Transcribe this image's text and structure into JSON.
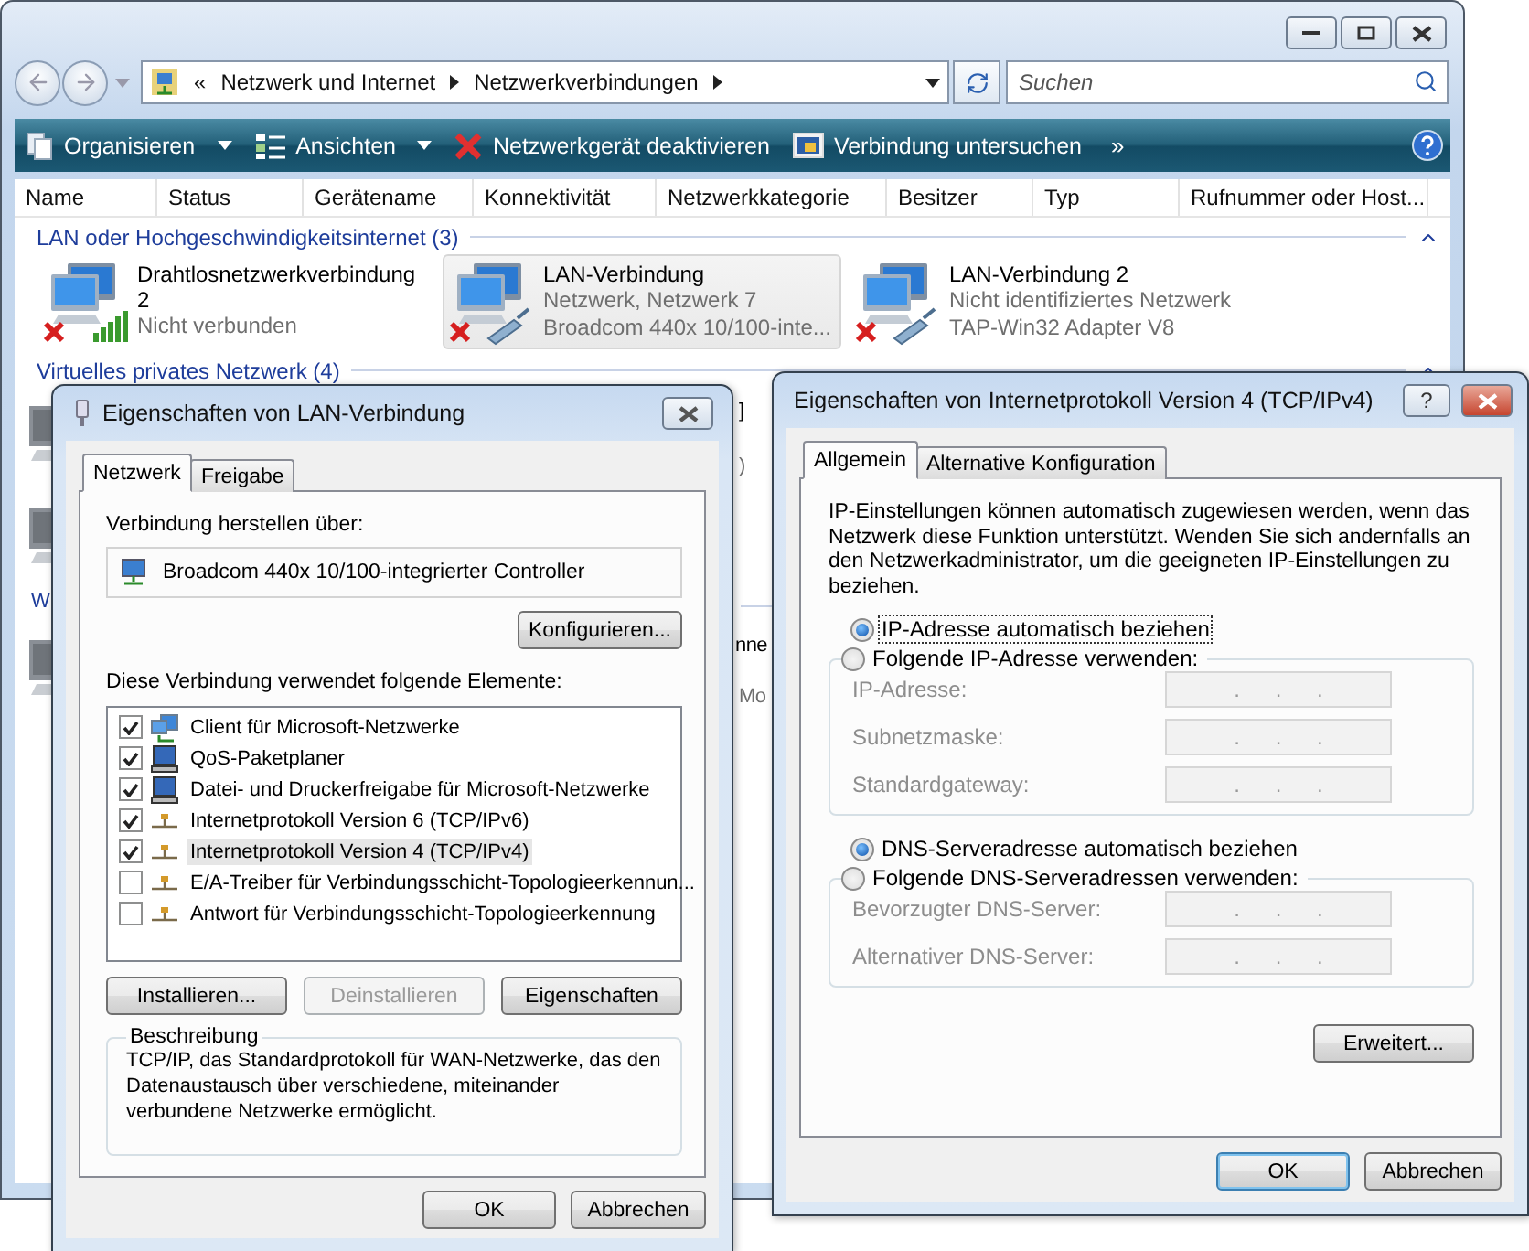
{
  "explorer": {
    "address": {
      "prefix": "«",
      "segments": [
        "Netzwerk und Internet",
        "Netzwerkverbindungen"
      ]
    },
    "search": {
      "placeholder": "Suchen"
    },
    "toolbar": [
      {
        "label": "Organisieren",
        "kind": "organize",
        "dropdown": true
      },
      {
        "label": "Ansichten",
        "kind": "views",
        "dropdown": true
      },
      {
        "label": "Netzwerkgerät deaktivieren",
        "kind": "disable",
        "dropdown": false
      },
      {
        "label": "Verbindung untersuchen",
        "kind": "diagnose",
        "dropdown": false
      }
    ],
    "overflow": "»",
    "columns": [
      "Name",
      "Status",
      "Gerätename",
      "Konnektivität",
      "Netzwerkkategorie",
      "Besitzer",
      "Typ",
      "Rufnummer oder Host..."
    ],
    "groups": [
      {
        "title": "LAN oder Hochgeschwindigkeitsinternet (3)",
        "expanded": true,
        "items": [
          {
            "name": "Drahtlosnetzwerkverbindung 2",
            "details": [
              "Nicht verbunden"
            ],
            "kind": "wireless",
            "disconnected": true,
            "selected": false
          },
          {
            "name": "LAN-Verbindung",
            "details": [
              "Netzwerk, Netzwerk  7",
              "Broadcom 440x 10/100-inte..."
            ],
            "kind": "wired",
            "disconnected": true,
            "selected": true
          },
          {
            "name": "LAN-Verbindung 2",
            "details": [
              "Nicht identifiziertes Netzwerk",
              "TAP-Win32 Adapter V8"
            ],
            "kind": "wired",
            "disconnected": true,
            "selected": false
          }
        ]
      },
      {
        "title": "Virtuelles privates Netzwerk (4)",
        "expanded": true
      }
    ],
    "fragments": [
      {
        "text": "]",
        "kind": "name"
      },
      {
        "text": ")",
        "kind": "detail"
      },
      {
        "text": "W",
        "kind": "group"
      },
      {
        "text": "nne",
        "kind": "name"
      },
      {
        "text": "Mo",
        "kind": "detail"
      }
    ]
  },
  "lan_dialog": {
    "title": "Eigenschaften von LAN-Verbindung",
    "tabs": [
      {
        "label": "Netzwerk",
        "selected": true
      },
      {
        "label": "Freigabe",
        "selected": false
      }
    ],
    "connect_label": "Verbindung herstellen über:",
    "adapter": "Broadcom 440x 10/100-integrierter Controller",
    "configure_button": "Konfigurieren...",
    "elements_label": "Diese Verbindung verwendet folgende Elemente:",
    "elements": [
      {
        "label": "Client für Microsoft-Netzwerke",
        "kind": "client",
        "checked": true,
        "selected": false
      },
      {
        "label": "QoS-Paketplaner",
        "kind": "service",
        "checked": true,
        "selected": false
      },
      {
        "label": "Datei- und Druckerfreigabe für Microsoft-Netzwerke",
        "kind": "service",
        "checked": true,
        "selected": false
      },
      {
        "label": "Internetprotokoll Version 6 (TCP/IPv6)",
        "kind": "protocol",
        "checked": true,
        "selected": false
      },
      {
        "label": "Internetprotokoll Version 4 (TCP/IPv4)",
        "kind": "protocol",
        "checked": true,
        "selected": true
      },
      {
        "label": "E/A-Treiber für Verbindungsschicht-Topologieerkennun...",
        "kind": "protocol",
        "checked": false,
        "selected": false
      },
      {
        "label": "Antwort für Verbindungsschicht-Topologieerkennung",
        "kind": "protocol",
        "checked": false,
        "selected": false
      }
    ],
    "element_buttons": [
      {
        "label": "Installieren...",
        "disabled": false
      },
      {
        "label": "Deinstallieren",
        "disabled": true
      },
      {
        "label": "Eigenschaften",
        "disabled": false
      }
    ],
    "description": {
      "title": "Beschreibung",
      "text": "TCP/IP, das Standardprotokoll für WAN-Netzwerke, das den Datenaustausch über verschiedene, miteinander verbundene Netzwerke ermöglicht."
    },
    "buttons": [
      {
        "label": "OK",
        "default": false
      },
      {
        "label": "Abbrechen",
        "default": false
      }
    ]
  },
  "ipv4_dialog": {
    "title": "Eigenschaften von Internetprotokoll Version 4 (TCP/IPv4)",
    "help": "?",
    "tabs": [
      {
        "label": "Allgemein",
        "selected": true
      },
      {
        "label": "Alternative Konfiguration",
        "selected": false
      }
    ],
    "intro": "IP-Einstellungen können automatisch zugewiesen werden, wenn das Netzwerk diese Funktion unterstützt. Wenden Sie sich andernfalls an den Netzwerkadministrator, um die geeigneten IP-Einstellungen zu beziehen.",
    "sections": [
      {
        "auto": {
          "label": "IP-Adresse automatisch beziehen",
          "selected": true,
          "focused": true
        },
        "manual": {
          "label": "Folgende IP-Adresse verwenden:",
          "selected": false
        },
        "fields": [
          {
            "label": "IP-Adresse:",
            "value": ". . .",
            "disabled": true
          },
          {
            "label": "Subnetzmaske:",
            "value": ". . .",
            "disabled": true
          },
          {
            "label": "Standardgateway:",
            "value": ". . .",
            "disabled": true
          }
        ]
      },
      {
        "auto": {
          "label": "DNS-Serveradresse automatisch beziehen",
          "selected": true,
          "focused": false
        },
        "manual": {
          "label": "Folgende DNS-Serveradressen verwenden:",
          "selected": false
        },
        "fields": [
          {
            "label": "Bevorzugter DNS-Server:",
            "value": ". . .",
            "disabled": true
          },
          {
            "label": "Alternativer DNS-Server:",
            "value": ". . .",
            "disabled": true
          }
        ]
      }
    ],
    "advanced_button": "Erweitert...",
    "buttons": [
      {
        "label": "OK",
        "default": true
      },
      {
        "label": "Abbrechen",
        "default": false
      }
    ]
  }
}
